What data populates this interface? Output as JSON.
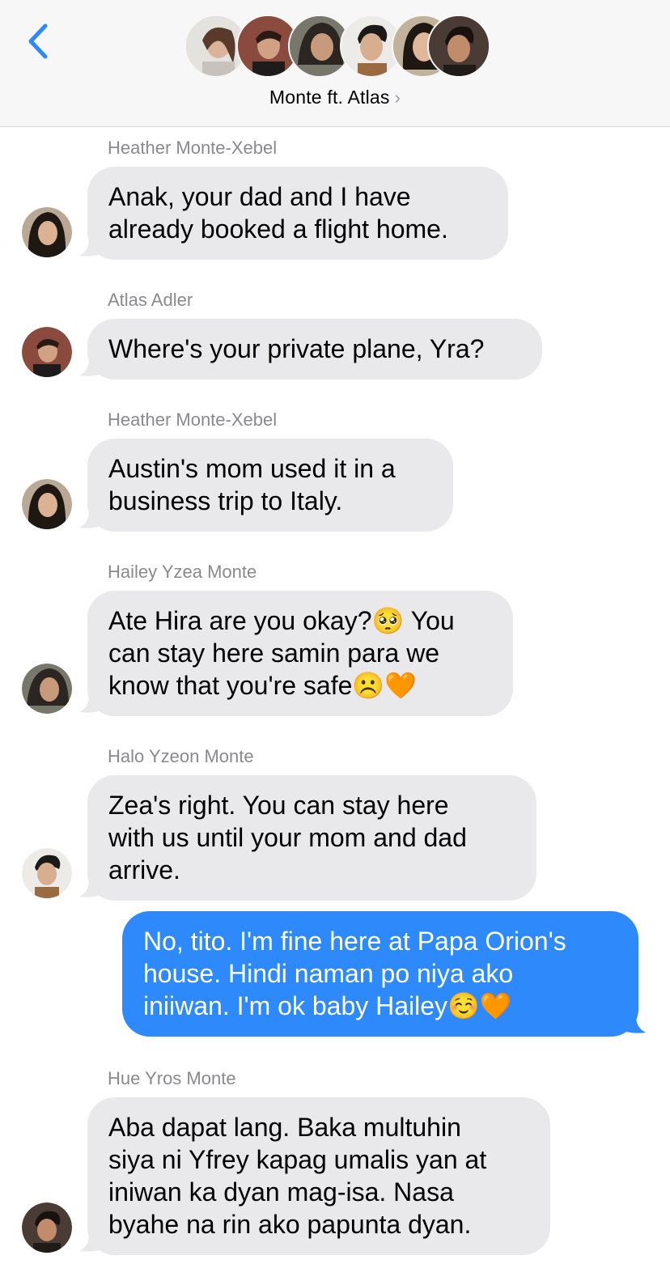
{
  "header": {
    "group_name": "Monte ft. Atlas",
    "chevron": "›",
    "icons": {
      "back": "chevron-left-icon",
      "details": "chevron-right-icon"
    }
  },
  "colors": {
    "accent": "#2e89fb",
    "incoming_bubble": "#e9e9eb",
    "sender_label": "#8a8a8e"
  },
  "messages": [
    {
      "sender": "Heather Monte-Xebel",
      "direction": "incoming",
      "text": "Anak, your dad and I have\nalready booked a flight home."
    },
    {
      "sender": "Atlas Adler",
      "direction": "incoming",
      "text": "Where's your private plane, Yra?"
    },
    {
      "sender": "Heather Monte-Xebel",
      "direction": "incoming",
      "text": "Austin's mom used it in a\nbusiness trip to Italy."
    },
    {
      "sender": "Hailey Yzea Monte",
      "direction": "incoming",
      "text": "Ate Hira are you okay?🥺 You\ncan stay here samin para we\nknow that you're safe☹️🧡"
    },
    {
      "sender": "Halo Yzeon Monte",
      "direction": "incoming",
      "text": "Zea's right. You can stay here\nwith us until your mom and dad\narrive."
    },
    {
      "sender": "",
      "direction": "outgoing",
      "text": "No, tito. I'm fine here at Papa Orion's\nhouse. Hindi naman po niya ako\niniiwan. I'm ok baby Hailey☺️🧡"
    },
    {
      "sender": "Hue Yros Monte",
      "direction": "incoming",
      "text": "Aba dapat lang. Baka multuhin\nsiya ni Yfrey kapag umalis yan at\niniwan ka dyan mag-isa. Nasa\nbyahe na rin ako papunta dyan."
    }
  ]
}
